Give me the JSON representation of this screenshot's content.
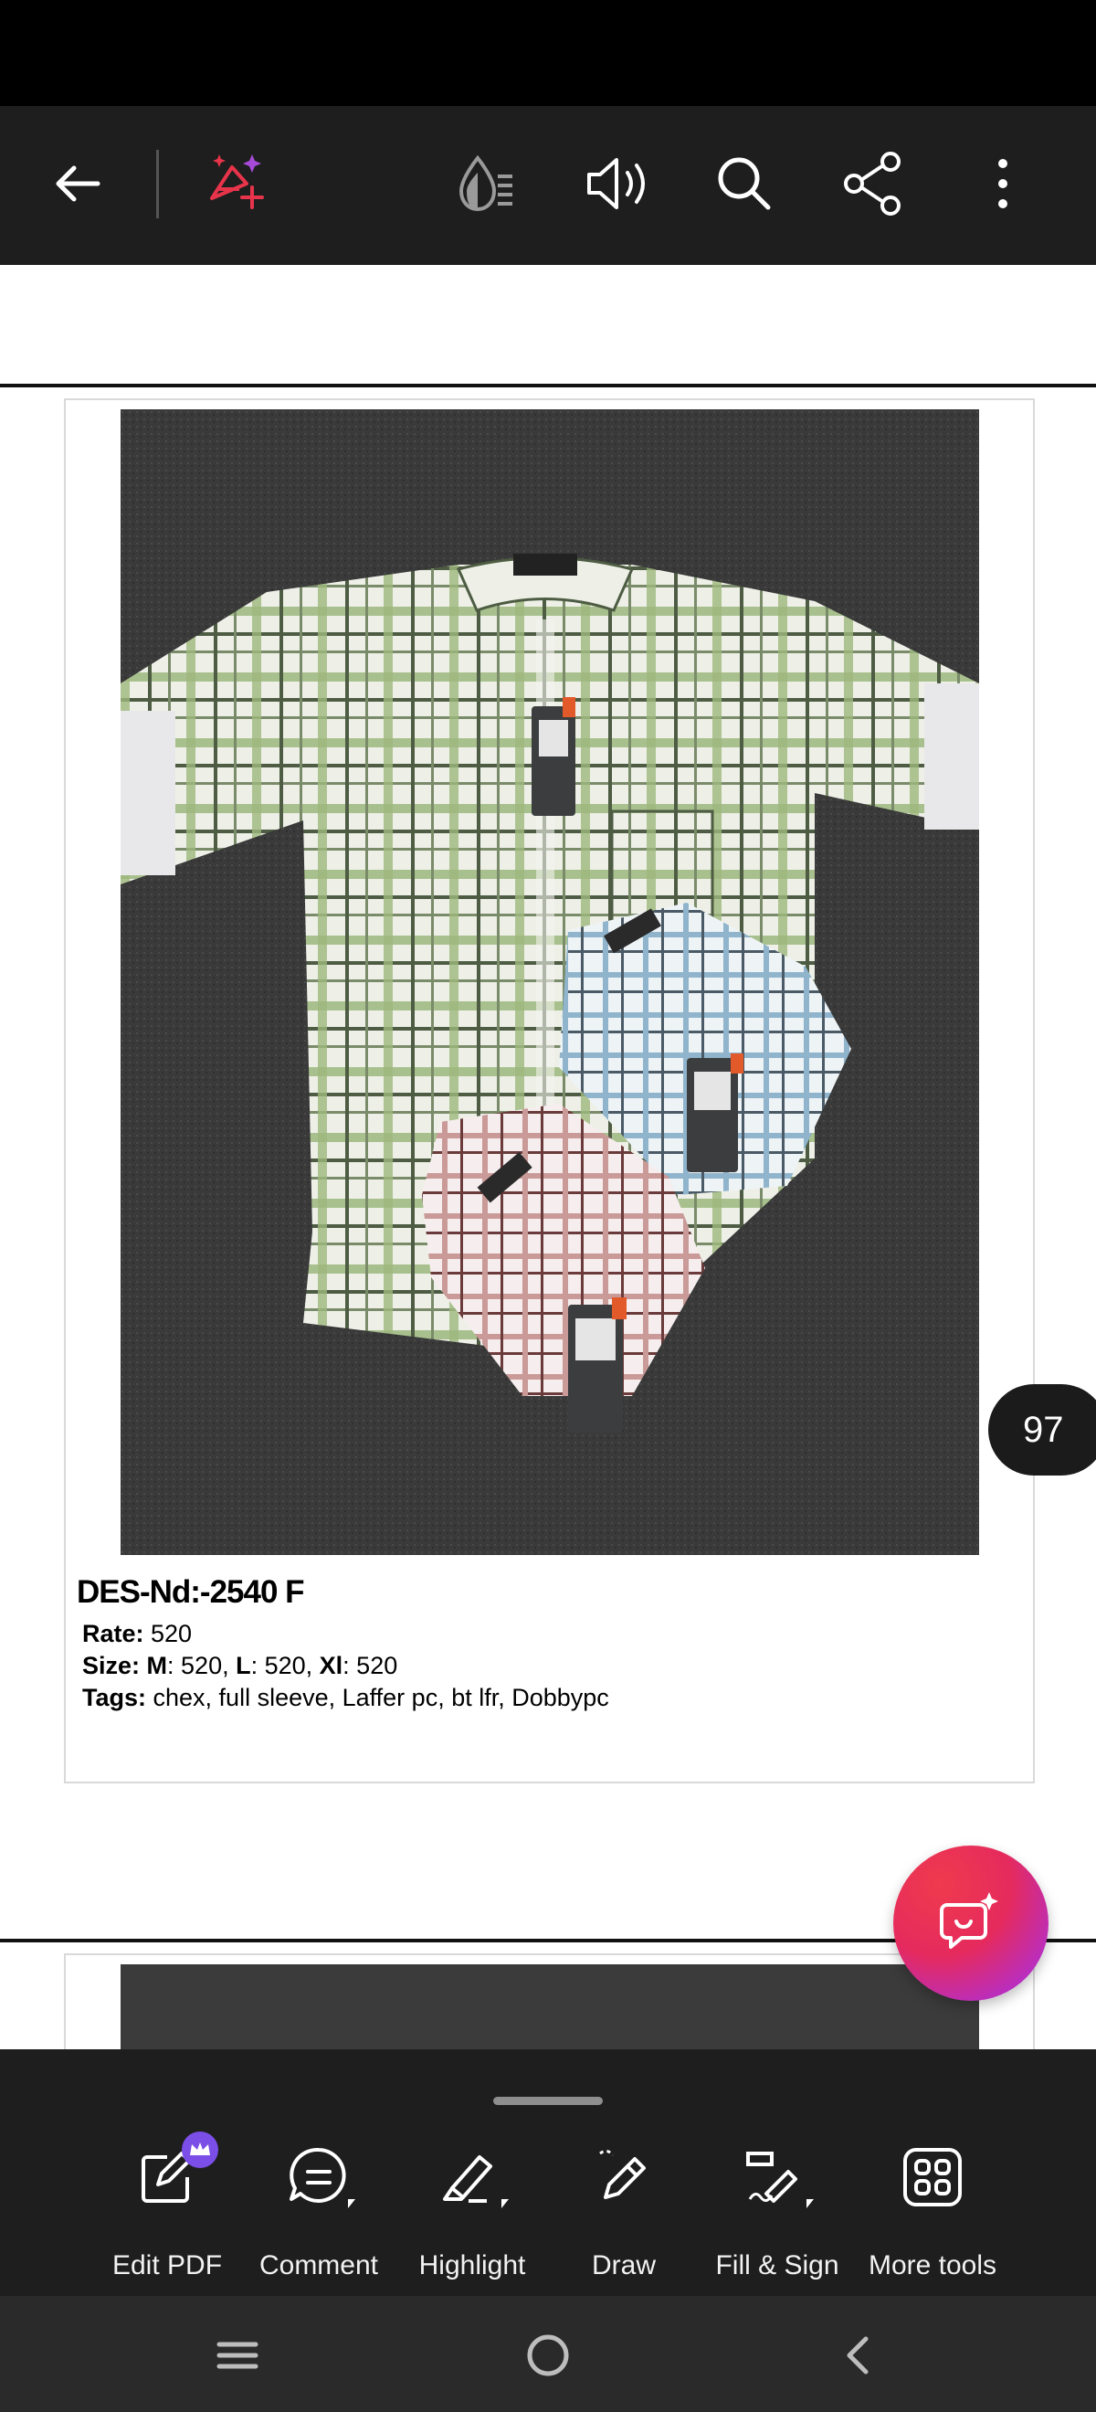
{
  "app": {
    "name": "PDF viewer",
    "accent_color": "#e8344a",
    "toolbar_bg": "#1e1e1e"
  },
  "toolbar": {
    "icons": [
      "back-arrow-icon",
      "ai-assistant-icon",
      "reading-mode-icon",
      "read-aloud-icon",
      "search-icon",
      "share-icon",
      "more-options-icon"
    ]
  },
  "document": {
    "current_page": "97",
    "product": {
      "title": "DES-Nd:-2540 F",
      "rate_label": "Rate:",
      "rate_value": " 520",
      "size_label": "Size:",
      "size_m_label": " M",
      "size_m_value": ": 520, ",
      "size_l_label": "L",
      "size_l_value": ": 520, ",
      "size_xl_label": "Xl",
      "size_xl_value": ": 520",
      "tags_label": "Tags:",
      "tags_value": " chex, full sleeve, Laffer pc, bt lfr, Dobbypc"
    }
  },
  "bottom_tools": [
    {
      "label": "Edit PDF",
      "icon": "edit-pdf-icon",
      "premium": true
    },
    {
      "label": "Comment",
      "icon": "comment-icon"
    },
    {
      "label": "Highlight",
      "icon": "highlight-icon"
    },
    {
      "label": "Draw",
      "icon": "draw-icon"
    },
    {
      "label": "Fill & Sign",
      "icon": "fill-sign-icon"
    },
    {
      "label": "More tools",
      "icon": "more-tools-icon"
    }
  ],
  "system_nav": [
    "recents-icon",
    "home-icon",
    "back-icon"
  ]
}
